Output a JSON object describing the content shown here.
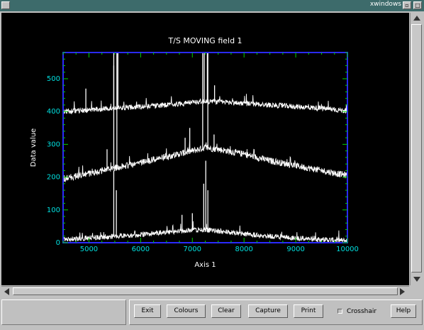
{
  "window": {
    "title": "xwindows"
  },
  "toolbar": {
    "exit_label": "Exit",
    "colours_label": "Colours",
    "clear_label": "Clear",
    "capture_label": "Capture",
    "print_label": "Print",
    "crosshair_label": "Crosshair",
    "crosshair_checked": false,
    "help_label": "Help"
  },
  "colors": {
    "background": "#000000",
    "frame": "#2a2aff",
    "ticks": "#00d000",
    "tick_labels": "#00e0e0",
    "trace": "#ffffff",
    "title_bar": "#3d6b6b"
  },
  "chart_data": {
    "type": "line",
    "title": "T/S MOVING field 1",
    "xlabel": "Axis 1",
    "ylabel": "Data value",
    "xlim": [
      4500,
      10000
    ],
    "ylim": [
      0,
      580
    ],
    "xticks": [
      5000,
      6000,
      7000,
      8000,
      9000,
      10000
    ],
    "yticks": [
      0,
      100,
      200,
      300,
      400,
      500
    ],
    "grid": false,
    "legend": "none",
    "series": [
      {
        "x": [
          4500,
          5000,
          5500,
          6000,
          6500,
          7000,
          7250,
          7500,
          8000,
          8500,
          9000,
          9500,
          10000
        ],
        "y": [
          400,
          405,
          410,
          415,
          420,
          428,
          432,
          430,
          425,
          420,
          415,
          410,
          402
        ],
        "noise": 8,
        "spikes": [
          [
            4940,
            470
          ],
          [
            5480,
            540
          ],
          [
            5560,
            580
          ],
          [
            7230,
            580
          ],
          [
            7290,
            580
          ],
          [
            7430,
            480
          ]
        ]
      },
      {
        "x": [
          4500,
          5000,
          5500,
          6000,
          6500,
          7000,
          7250,
          7500,
          8000,
          8500,
          9000,
          9500,
          10000
        ],
        "y": [
          195,
          210,
          228,
          245,
          262,
          280,
          290,
          285,
          270,
          250,
          235,
          220,
          205
        ],
        "noise": 10,
        "spikes": [
          [
            5350,
            285
          ],
          [
            5480,
            580
          ],
          [
            5540,
            580
          ],
          [
            6860,
            320
          ],
          [
            6950,
            350
          ],
          [
            7200,
            580
          ],
          [
            7300,
            580
          ],
          [
            7420,
            330
          ]
        ]
      },
      {
        "x": [
          4500,
          5000,
          5500,
          6000,
          6500,
          7000,
          7250,
          7500,
          8000,
          8500,
          9000,
          9500,
          10000
        ],
        "y": [
          10,
          14,
          20,
          25,
          32,
          38,
          40,
          35,
          28,
          20,
          14,
          10,
          6
        ],
        "noise": 8,
        "spikes": [
          [
            5480,
            220
          ],
          [
            5530,
            160
          ],
          [
            6800,
            85
          ],
          [
            7000,
            90
          ],
          [
            7220,
            180
          ],
          [
            7260,
            250
          ],
          [
            7300,
            160
          ]
        ]
      }
    ]
  }
}
